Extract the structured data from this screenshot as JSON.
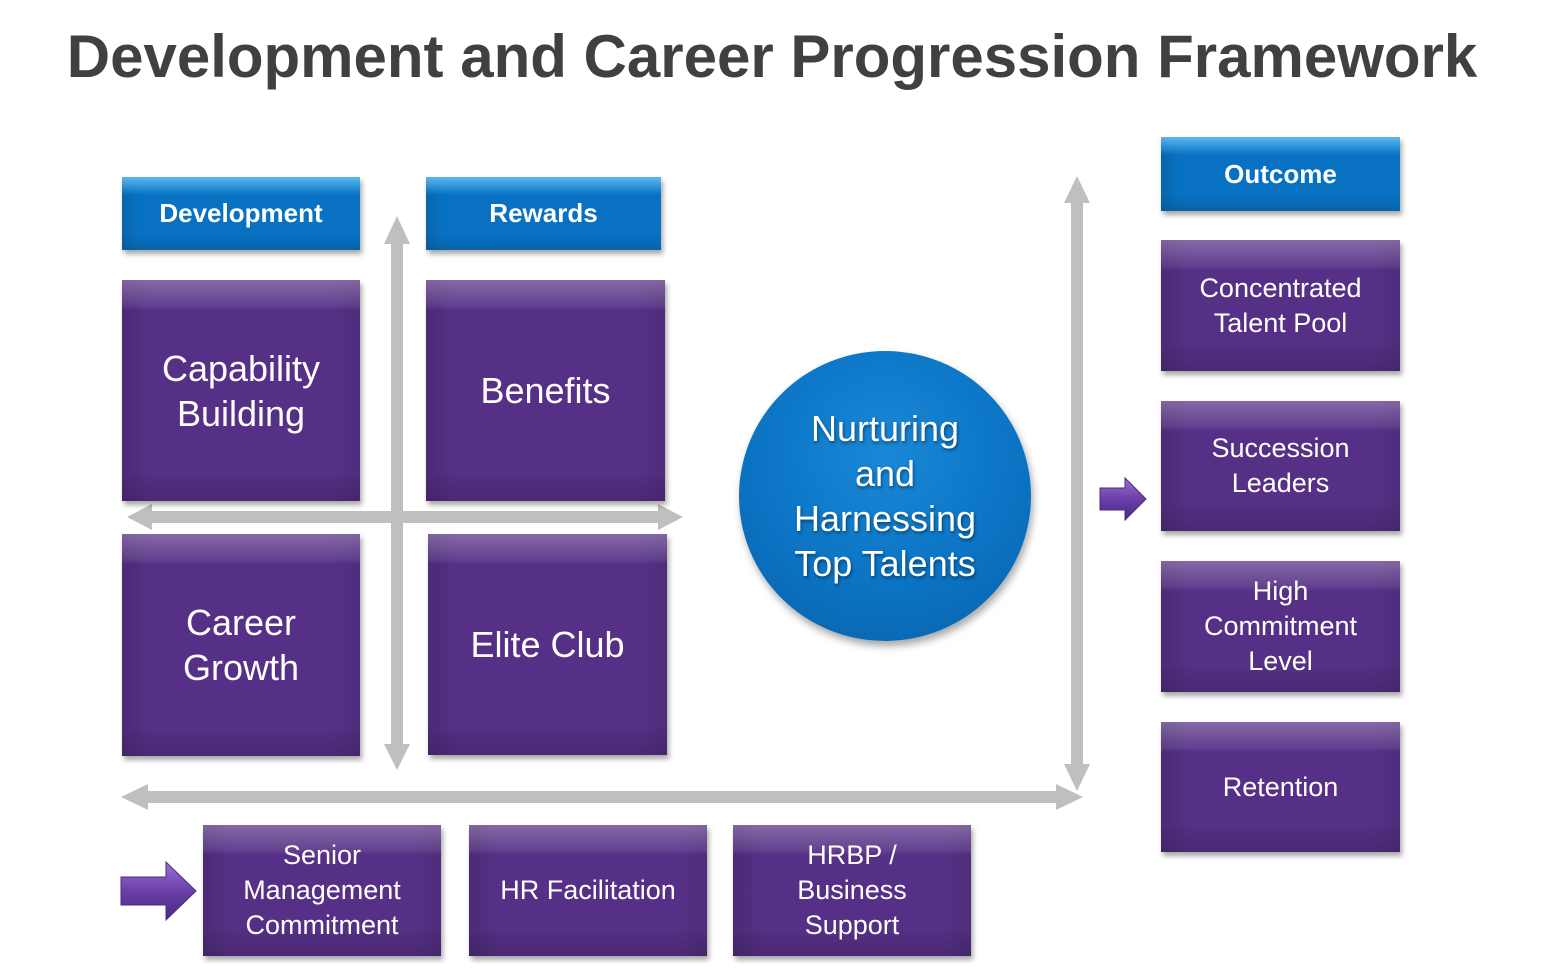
{
  "title": "Development and Career Progression Framework",
  "colors": {
    "purple_box": "#563086",
    "blue_header": "#0871c1",
    "arrow_gray": "#bfbfbf",
    "title_text": "#404040"
  },
  "quadrant": {
    "headers": {
      "development": "Development",
      "rewards": "Rewards"
    },
    "boxes": {
      "capability_building": "Capability\nBuilding",
      "benefits": "Benefits",
      "career_growth": "Career\nGrowth",
      "elite_club": "Elite Club"
    }
  },
  "center": {
    "label": "Nurturing\nand\nHarnessing\nTop Talents"
  },
  "outcome": {
    "header": "Outcome",
    "items": [
      "Concentrated\nTalent Pool",
      "Succession\nLeaders",
      "High\nCommitment\nLevel",
      "Retention"
    ]
  },
  "enablers": {
    "items": [
      "Senior\nManagement\nCommitment",
      "HR Facilitation",
      "HRBP /\nBusiness\nSupport"
    ]
  },
  "icons": {
    "axis_arrows": "double-headed-arrow",
    "pointer_arrows": "right-block-arrow"
  }
}
